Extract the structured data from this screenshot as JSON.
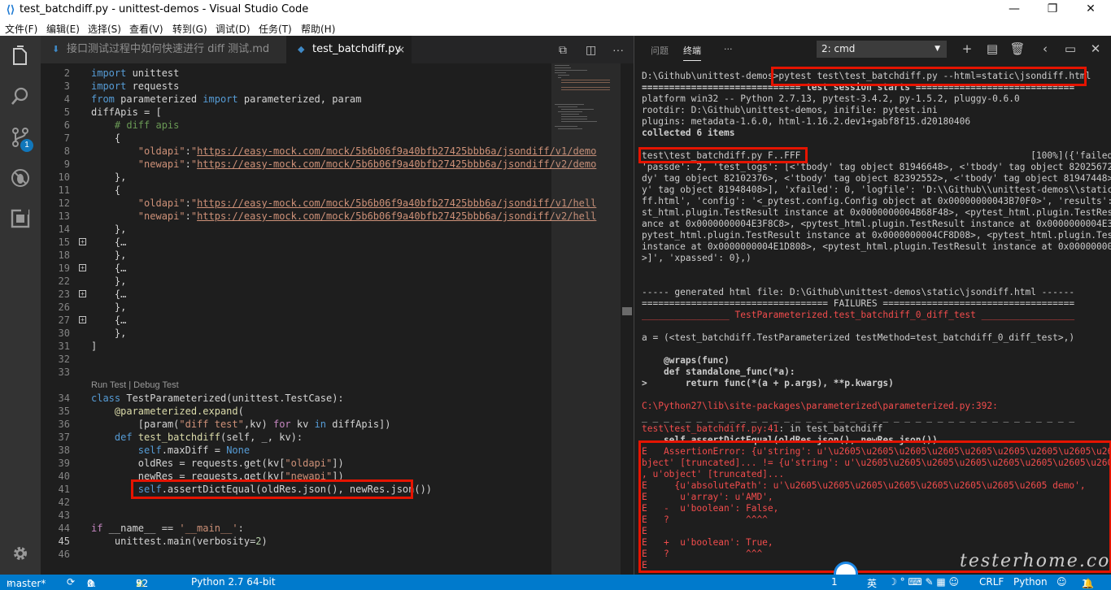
{
  "window": {
    "title": "test_batchdiff.py - unittest-demos - Visual Studio Code",
    "controls": {
      "minimize": "—",
      "maximize": "❐",
      "close": "✕"
    }
  },
  "menu": [
    "文件(F)",
    "编辑(E)",
    "选择(S)",
    "查看(V)",
    "转到(G)",
    "调试(D)",
    "任务(T)",
    "帮助(H)"
  ],
  "activity_bar": {
    "scm_badge": "1",
    "icons": [
      "files-icon",
      "search-icon",
      "source-control-icon",
      "debug-icon",
      "extensions-icon",
      "settings-gear-icon"
    ]
  },
  "tabs": [
    {
      "label": "接口测试过程中如何快速进行 diff 测试.md",
      "icon": "markdown-icon",
      "active": false
    },
    {
      "label": "test_batchdiff.py",
      "icon": "python-file-icon",
      "active": true,
      "close": "×"
    }
  ],
  "editor": {
    "codelens": "Run Test | Debug Test",
    "lines": [
      {
        "n": "2",
        "t": [
          [
            "kw",
            "import"
          ],
          [
            "pl",
            " unittest"
          ]
        ]
      },
      {
        "n": "3",
        "t": [
          [
            "kw",
            "import"
          ],
          [
            "pl",
            " requests"
          ]
        ]
      },
      {
        "n": "4",
        "t": [
          [
            "kw",
            "from"
          ],
          [
            "pl",
            " parameterized "
          ],
          [
            "kw",
            "import"
          ],
          [
            "pl",
            " parameterized, param"
          ]
        ]
      },
      {
        "n": "5",
        "t": [
          [
            "pl",
            "diffApis = ["
          ]
        ]
      },
      {
        "n": "6",
        "t": [
          [
            "cm",
            "    # diff apis"
          ]
        ]
      },
      {
        "n": "7",
        "t": [
          [
            "pl",
            "    {"
          ]
        ]
      },
      {
        "n": "8",
        "t": [
          [
            "pl",
            "        "
          ],
          [
            "str",
            "\"oldapi\""
          ],
          [
            "pl",
            ":"
          ],
          [
            "str",
            "\""
          ],
          [
            "url",
            "https://easy-mock.com/mock/5b6b06f9a40bfb27425bbb6a/jsondiff/v1/demo"
          ]
        ]
      },
      {
        "n": "9",
        "t": [
          [
            "pl",
            "        "
          ],
          [
            "str",
            "\"newapi\""
          ],
          [
            "pl",
            ":"
          ],
          [
            "str",
            "\""
          ],
          [
            "url",
            "https://easy-mock.com/mock/5b6b06f9a40bfb27425bbb6a/jsondiff/v2/demo"
          ]
        ]
      },
      {
        "n": "10",
        "t": [
          [
            "pl",
            "    },"
          ]
        ]
      },
      {
        "n": "11",
        "t": [
          [
            "pl",
            "    {"
          ]
        ]
      },
      {
        "n": "12",
        "t": [
          [
            "pl",
            "        "
          ],
          [
            "str",
            "\"oldapi\""
          ],
          [
            "pl",
            ":"
          ],
          [
            "str",
            "\""
          ],
          [
            "url",
            "https://easy-mock.com/mock/5b6b06f9a40bfb27425bbb6a/jsondiff/v1/hell"
          ]
        ]
      },
      {
        "n": "13",
        "t": [
          [
            "pl",
            "        "
          ],
          [
            "str",
            "\"newapi\""
          ],
          [
            "pl",
            ":"
          ],
          [
            "str",
            "\""
          ],
          [
            "url",
            "https://easy-mock.com/mock/5b6b06f9a40bfb27425bbb6a/jsondiff/v2/hell"
          ]
        ]
      },
      {
        "n": "14",
        "t": [
          [
            "pl",
            "    },"
          ]
        ]
      },
      {
        "n": "15",
        "fold": true,
        "t": [
          [
            "pl",
            "    {…"
          ]
        ]
      },
      {
        "n": "18",
        "t": [
          [
            "pl",
            "    },"
          ]
        ]
      },
      {
        "n": "19",
        "fold": true,
        "t": [
          [
            "pl",
            "    {…"
          ]
        ]
      },
      {
        "n": "22",
        "t": [
          [
            "pl",
            "    },"
          ]
        ]
      },
      {
        "n": "23",
        "fold": true,
        "t": [
          [
            "pl",
            "    {…"
          ]
        ]
      },
      {
        "n": "26",
        "t": [
          [
            "pl",
            "    },"
          ]
        ]
      },
      {
        "n": "27",
        "fold": true,
        "t": [
          [
            "pl",
            "    {…"
          ]
        ]
      },
      {
        "n": "30",
        "t": [
          [
            "pl",
            "    },"
          ]
        ]
      },
      {
        "n": "31",
        "t": [
          [
            "pl",
            "]"
          ]
        ]
      },
      {
        "n": "32",
        "t": []
      },
      {
        "n": "33",
        "t": []
      },
      {
        "n": "34",
        "t": [
          [
            "kw",
            "class"
          ],
          [
            "pl",
            " TestParameterized(unittest.TestCase):"
          ]
        ]
      },
      {
        "n": "35",
        "t": [
          [
            "pl",
            "    "
          ],
          [
            "fn",
            "@parameterized.expand"
          ],
          [
            "pl",
            "("
          ]
        ]
      },
      {
        "n": "36",
        "t": [
          [
            "pl",
            "        [param("
          ],
          [
            "str",
            "\"diff test\""
          ],
          [
            "pl",
            ",kv) "
          ],
          [
            "kw2",
            "for"
          ],
          [
            "pl",
            " kv "
          ],
          [
            "kw",
            "in"
          ],
          [
            "pl",
            " diffApis])"
          ]
        ]
      },
      {
        "n": "37",
        "t": [
          [
            "pl",
            "    "
          ],
          [
            "kw",
            "def"
          ],
          [
            "pl",
            " "
          ],
          [
            "fn",
            "test_batchdiff"
          ],
          [
            "pl",
            "(self, _, kv):"
          ]
        ]
      },
      {
        "n": "38",
        "t": [
          [
            "pl",
            "        "
          ],
          [
            "kw",
            "self"
          ],
          [
            "pl",
            ".maxDiff = "
          ],
          [
            "kw",
            "None"
          ]
        ]
      },
      {
        "n": "39",
        "t": [
          [
            "pl",
            "        oldRes = requests.get(kv["
          ],
          [
            "str",
            "\"oldapi\""
          ],
          [
            "pl",
            "])"
          ]
        ]
      },
      {
        "n": "40",
        "t": [
          [
            "pl",
            "        newRes = requests.get(kv["
          ],
          [
            "str",
            "\"newapi\""
          ],
          [
            "pl",
            "])"
          ]
        ]
      },
      {
        "n": "41",
        "t": [
          [
            "pl",
            "        "
          ],
          [
            "kw",
            "self"
          ],
          [
            "pl",
            ".assertDictEqual(oldRes.json(), newRes.json())"
          ]
        ]
      },
      {
        "n": "42",
        "t": []
      },
      {
        "n": "43",
        "t": []
      },
      {
        "n": "44",
        "t": [
          [
            "kw2",
            "if"
          ],
          [
            "pl",
            " __name__ == "
          ],
          [
            "str",
            "'__main__'"
          ],
          [
            "pl",
            ":"
          ]
        ]
      },
      {
        "n": "45",
        "t": [
          [
            "pl",
            "    unittest.main(verbosity="
          ],
          [
            "nm",
            "2"
          ],
          [
            "pl",
            ")"
          ]
        ]
      },
      {
        "n": "46",
        "t": []
      }
    ]
  },
  "panel": {
    "tabs": [
      "问题",
      "终端",
      "···"
    ],
    "terminal_select": "2: cmd",
    "terminal_lines": [
      {
        "t": "D:\\Github\\unittest-demos>pytest test\\test_batchdiff.py --html=static\\jsondiff.html",
        "c": "n"
      },
      {
        "t": "============================= test session starts =============================",
        "c": "b"
      },
      {
        "t": "platform win32 -- Python 2.7.13, pytest-3.4.2, py-1.5.2, pluggy-0.6.0",
        "c": "n"
      },
      {
        "t": "rootdir: D:\\Github\\unittest-demos, inifile: pytest.ini",
        "c": "n"
      },
      {
        "t": "plugins: metadata-1.6.0, html-1.16.2.dev1+gabf8f15.d20180406",
        "c": "n"
      },
      {
        "t": "collected 6 items",
        "c": "b"
      },
      {
        "t": "",
        "c": "n"
      },
      {
        "t": "test\\test_batchdiff.py F..FFF                                          [100%]({'failed",
        "c": "n"
      },
      {
        "t": "'passde': 2, 'test_logs': [<'tbody' tag object 81946648>, <'tbody' tag object 82025672",
        "c": "n"
      },
      {
        "t": "dy' tag object 82102376>, <'tbody' tag object 82392552>, <'tbody' tag object 81947448>,",
        "c": "n"
      },
      {
        "t": "y' tag object 81948408>], 'xfailed': 0, 'logfile': 'D:\\\\Github\\\\unittest-demos\\\\static\\",
        "c": "n"
      },
      {
        "t": "ff.html', 'config': '<_pytest.config.Config object at 0x00000000043B70F0>', 'results':",
        "c": "n"
      },
      {
        "t": "st_html.plugin.TestResult instance at 0x0000000004B68F48>, <pytest_html.plugin.TestResul",
        "c": "n"
      },
      {
        "t": "ance at 0x0000000004E3F8C8>, <pytest_html.plugin.TestResult instance at 0x0000000004E3FE",
        "c": "n"
      },
      {
        "t": "pytest_html.plugin.TestResult instance at 0x0000000004CF8D08>, <pytest_html.plugin.TestR",
        "c": "n"
      },
      {
        "t": "instance at 0x0000000004E1D808>, <pytest_html.plugin.TestResult instance at 0x000000000",
        "c": "n"
      },
      {
        "t": ">]', 'xpassed': 0},)",
        "c": "n"
      },
      {
        "t": "",
        "c": "n"
      },
      {
        "t": "",
        "c": "n"
      },
      {
        "t": "----- generated html file: D:\\Github\\unittest-demos\\static\\jsondiff.html ------",
        "c": "n"
      },
      {
        "t": "================================== FAILURES ===================================",
        "c": "n"
      },
      {
        "t": "________________ TestParameterized.test_batchdiff_0_diff_test _________________",
        "c": "r"
      },
      {
        "t": "",
        "c": "n"
      },
      {
        "t": "a = (<test_batchdiff.TestParameterized testMethod=test_batchdiff_0_diff_test>,)",
        "c": "n"
      },
      {
        "t": "",
        "c": "n"
      },
      {
        "t": "    @wraps(func)",
        "c": "b"
      },
      {
        "t": "    def standalone_func(*a):",
        "c": "b"
      },
      {
        "t": ">       return func(*(a + p.args), **p.kwargs)",
        "c": "b"
      },
      {
        "t": "",
        "c": "n"
      },
      {
        "t": "C:\\Python27\\lib\\site-packages\\parameterized\\parameterized.py:392:",
        "c": "r"
      },
      {
        "t": "_ _ _ _ _ _ _ _ _ _ _ _ _ _ _ _ _ _ _ _ _ _ _ _ _ _ _ _ _ _ _ _ _ _ _ _ _ _ _ _",
        "c": "n"
      },
      {
        "t": "test\\test_batchdiff.py:41: in test_batchdiff",
        "c": "rn"
      },
      {
        "t": "    self.assertDictEqual(oldRes.json(), newRes.json())",
        "c": "b"
      },
      {
        "t": "E   AssertionError: {u'string': u'\\u2605\\u2605\\u2605\\u2605\\u2605\\u2605\\u2605\\u2605\\u260",
        "c": "r"
      },
      {
        "t": "bject' [truncated]... != {u'string': u'\\u2605\\u2605\\u2605\\u2605\\u2605\\u2605\\u2605\\u2605",
        "c": "r"
      },
      {
        "t": ", u'object' [truncated]...",
        "c": "r"
      },
      {
        "t": "E     {u'absolutePath': u'\\u2605\\u2605\\u2605\\u2605\\u2605\\u2605\\u2605\\u2605 demo',",
        "c": "r"
      },
      {
        "t": "E      u'array': u'AMD',",
        "c": "r"
      },
      {
        "t": "E   -  u'boolean': False,",
        "c": "r"
      },
      {
        "t": "E   ?              ^^^^",
        "c": "r"
      },
      {
        "t": "E",
        "c": "r"
      },
      {
        "t": "E   +  u'boolean': True,",
        "c": "r"
      },
      {
        "t": "E   ?              ^^^",
        "c": "r"
      },
      {
        "t": "E",
        "c": "r"
      }
    ]
  },
  "statusbar": {
    "branch": "master*",
    "errors": "0",
    "warnings": "0",
    "up": "52",
    "alerts": "9",
    "interpreter": "Python 2.7 64-bit",
    "lnlabel": "1",
    "ime": "英",
    "eol": "CRLF",
    "language": "Python",
    "notifications": "1"
  },
  "watermark": "testerhome.com"
}
